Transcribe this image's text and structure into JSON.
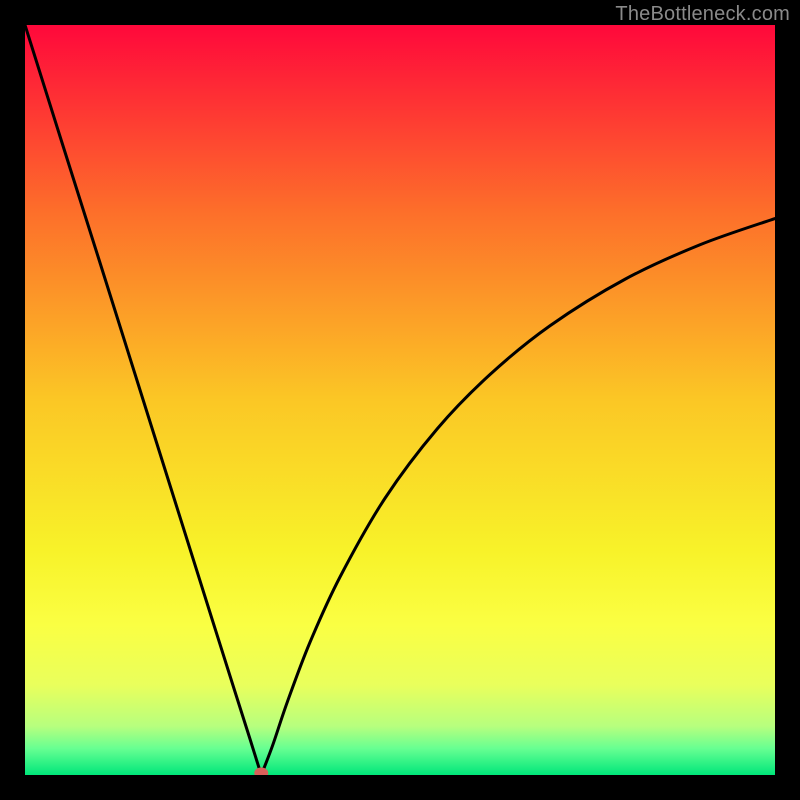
{
  "watermark": "TheBottleneck.com",
  "chart_data": {
    "type": "line",
    "title": "",
    "xlabel": "",
    "ylabel": "",
    "xlim": [
      0,
      100
    ],
    "ylim": [
      0,
      100
    ],
    "series": [
      {
        "name": "bottleneck-curve",
        "x": [
          0,
          5,
          10,
          15,
          20,
          25,
          28,
          30,
          31.5,
          33,
          35,
          38,
          42,
          48,
          55,
          62,
          70,
          80,
          90,
          100
        ],
        "y": [
          100,
          84.1,
          68.3,
          52.4,
          36.5,
          20.6,
          11.1,
          4.8,
          0,
          3.9,
          9.8,
          17.7,
          26.4,
          36.9,
          46.2,
          53.4,
          59.9,
          66.1,
          70.7,
          74.2
        ]
      }
    ],
    "marker": {
      "x": 31.5,
      "y": 0,
      "color": "#d9605a"
    },
    "gradient": {
      "stops": [
        {
          "offset": 0.0,
          "color": "#ff083b"
        },
        {
          "offset": 0.25,
          "color": "#fd6f2a"
        },
        {
          "offset": 0.5,
          "color": "#fbc725"
        },
        {
          "offset": 0.7,
          "color": "#f8f229"
        },
        {
          "offset": 0.8,
          "color": "#faff43"
        },
        {
          "offset": 0.88,
          "color": "#e9ff5c"
        },
        {
          "offset": 0.935,
          "color": "#b7ff7e"
        },
        {
          "offset": 0.965,
          "color": "#66ff92"
        },
        {
          "offset": 1.0,
          "color": "#00e67a"
        }
      ]
    }
  }
}
